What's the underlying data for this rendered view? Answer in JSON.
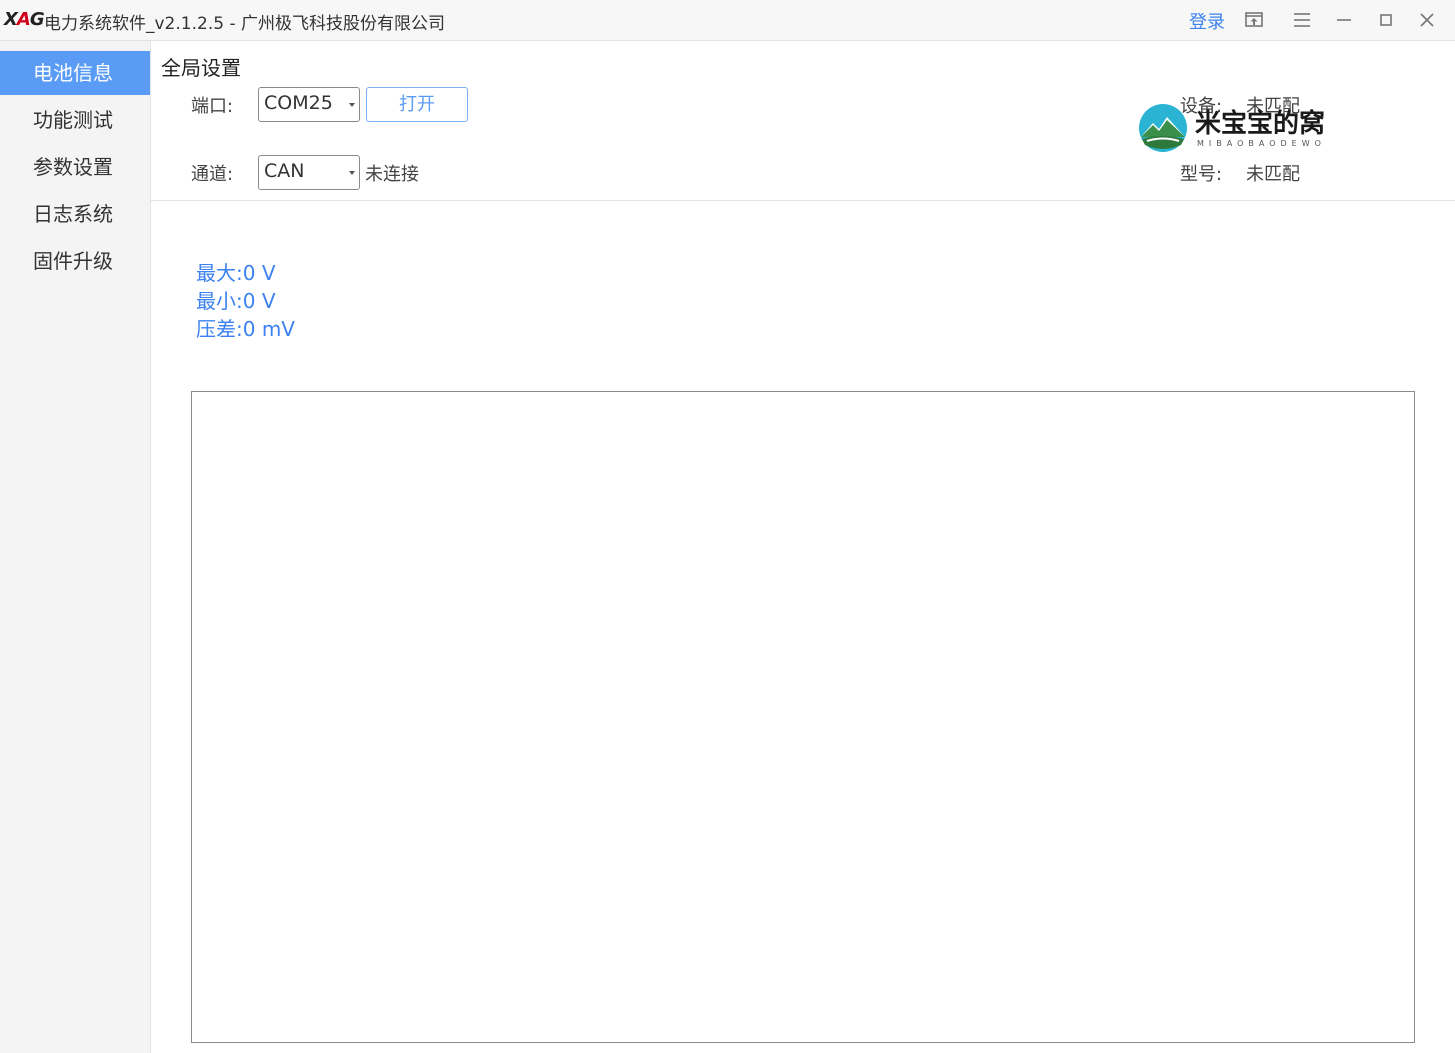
{
  "titlebar": {
    "logo_prefix": "X",
    "logo_accent": "A",
    "logo_suffix": "G",
    "title": "电力系统软件_v2.1.2.5 - 广州极飞科技股份有限公司",
    "login": "登录",
    "buttons": [
      "pin-icon",
      "menu-icon",
      "minimize-icon",
      "maximize-icon",
      "close-icon"
    ]
  },
  "sidebar": {
    "active_index": 0,
    "items": [
      {
        "label": "电池信息"
      },
      {
        "label": "功能测试"
      },
      {
        "label": "参数设置"
      },
      {
        "label": "日志系统"
      },
      {
        "label": "固件升级"
      }
    ]
  },
  "settings": {
    "title": "全局设置",
    "port_label": "端口:",
    "port_value": "COM25",
    "open_button": "打开",
    "channel_label": "通道:",
    "channel_value": "CAN",
    "connection_status": "未连接",
    "device_label": "设备:",
    "device_value": "未匹配",
    "model_label": "型号:",
    "model_value": "未匹配"
  },
  "watermark": {
    "text": "米宝宝的窝",
    "subtext": "MIBAOBAODEWO"
  },
  "stats": {
    "max": "最大:0 V",
    "min": "最小:0 V",
    "diff": "压差:0 mV"
  },
  "colors": {
    "accent": "#5a9bf5",
    "link": "#3c82f0",
    "sidebar_bg": "#f4f4f4"
  }
}
